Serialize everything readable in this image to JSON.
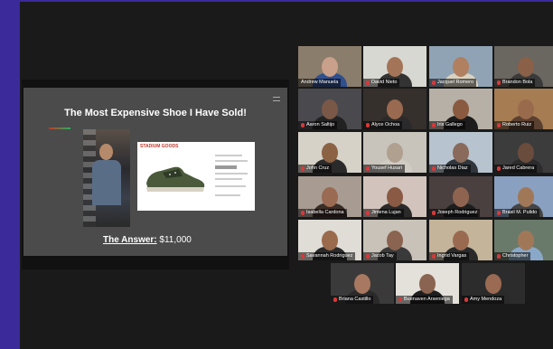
{
  "slide": {
    "title": "The Most Expensive Shoe I Have Sold!",
    "answer_label": "The Answer:",
    "answer_value": "$11,000",
    "site_logo": "STADIUM GOODS"
  },
  "participants": [
    {
      "name": "Andrew Manuela",
      "muted": false,
      "active": true,
      "bg": "#8b7d6b",
      "skin": "#c9a08a",
      "shirt": "#2f4f8f"
    },
    {
      "name": "David Nieto",
      "muted": true,
      "active": false,
      "bg": "#d8d8d2",
      "skin": "#a47458",
      "shirt": "#333"
    },
    {
      "name": "Jacquel Romero",
      "muted": true,
      "active": false,
      "bg": "#8fa3b5",
      "skin": "#b08060",
      "shirt": "#d9d2c0"
    },
    {
      "name": "Brandon Bola",
      "muted": true,
      "active": false,
      "bg": "#6a6660",
      "skin": "#8a6048",
      "shirt": "#3a3a3a"
    },
    {
      "name": "Aaron Saltijo",
      "muted": true,
      "active": false,
      "bg": "#4a4a4e",
      "skin": "#7a5848",
      "shirt": "#222"
    },
    {
      "name": "Alyce Ochoa",
      "muted": true,
      "active": false,
      "bg": "#35302c",
      "skin": "#9a6a50",
      "shirt": "#2a2a2a"
    },
    {
      "name": "Iris Gallego",
      "muted": true,
      "active": false,
      "bg": "#b7b0a6",
      "skin": "#8a5a40",
      "shirt": "#1c1c1c"
    },
    {
      "name": "Roberto Ruiz",
      "muted": true,
      "active": false,
      "bg": "#a67c52",
      "skin": "#9a6a4c",
      "shirt": "#5a4030"
    },
    {
      "name": "John Cruz",
      "muted": true,
      "active": false,
      "bg": "#d6d2c8",
      "skin": "#8c6244",
      "shirt": "#2a2a2a"
    },
    {
      "name": "Yousef Husari",
      "muted": true,
      "active": false,
      "bg": "#c8c4bc",
      "skin": "#b0a090",
      "shirt": "#d0ccc4"
    },
    {
      "name": "Nicholas Diaz",
      "muted": true,
      "active": false,
      "bg": "#b7c3cf",
      "skin": "#8a6a5a",
      "shirt": "#30363c"
    },
    {
      "name": "Jared Cabrera",
      "muted": true,
      "active": false,
      "bg": "#3c3c3c",
      "skin": "#6a4c3c",
      "shirt": "#2c2c2c"
    },
    {
      "name": "Isabella Cardona",
      "muted": true,
      "active": false,
      "bg": "#a89c92",
      "skin": "#9a6a52",
      "shirt": "#3a2c26"
    },
    {
      "name": "Jimena Lujan",
      "muted": true,
      "active": false,
      "bg": "#d2c4bc",
      "skin": "#8a5a44",
      "shirt": "#2a2a2a"
    },
    {
      "name": "Joseph Rodriguez",
      "muted": true,
      "active": false,
      "bg": "#4a4040",
      "skin": "#8e6450",
      "shirt": "#1e1e1e"
    },
    {
      "name": "Brasil M. Pulido",
      "muted": true,
      "active": false,
      "bg": "#8aa0c0",
      "skin": "#a07858",
      "shirt": "#444"
    },
    {
      "name": "Savannah Rodriguez",
      "muted": true,
      "active": false,
      "bg": "#e0dcd6",
      "skin": "#9a6a4c",
      "shirt": "#2a2a2a"
    },
    {
      "name": "Jacob Tay",
      "muted": true,
      "active": false,
      "bg": "#c9c2b8",
      "skin": "#8a6450",
      "shirt": "#3a3a3a"
    },
    {
      "name": "Ingrid Vargas",
      "muted": true,
      "active": false,
      "bg": "#c4b49a",
      "skin": "#9a6a50",
      "shirt": "#2a2a2a"
    },
    {
      "name": "Christopher",
      "muted": true,
      "active": false,
      "bg": "#6a7a6a",
      "skin": "#a07858",
      "shirt": "#8aa8c8"
    },
    {
      "name": "Briana Castillo",
      "muted": true,
      "active": false,
      "bg": "#3a3a3a",
      "skin": "#a87860",
      "shirt": "#2a2a2a"
    },
    {
      "name": "Buenaven Arseniega",
      "muted": true,
      "active": false,
      "bg": "#e4e0da",
      "skin": "#8a6450",
      "shirt": "#1e1e1e"
    },
    {
      "name": "Amy Mendoza",
      "muted": true,
      "active": false,
      "bg": "#2c2c2c",
      "skin": "#9a6a52",
      "shirt": "#2a2a2a"
    }
  ]
}
